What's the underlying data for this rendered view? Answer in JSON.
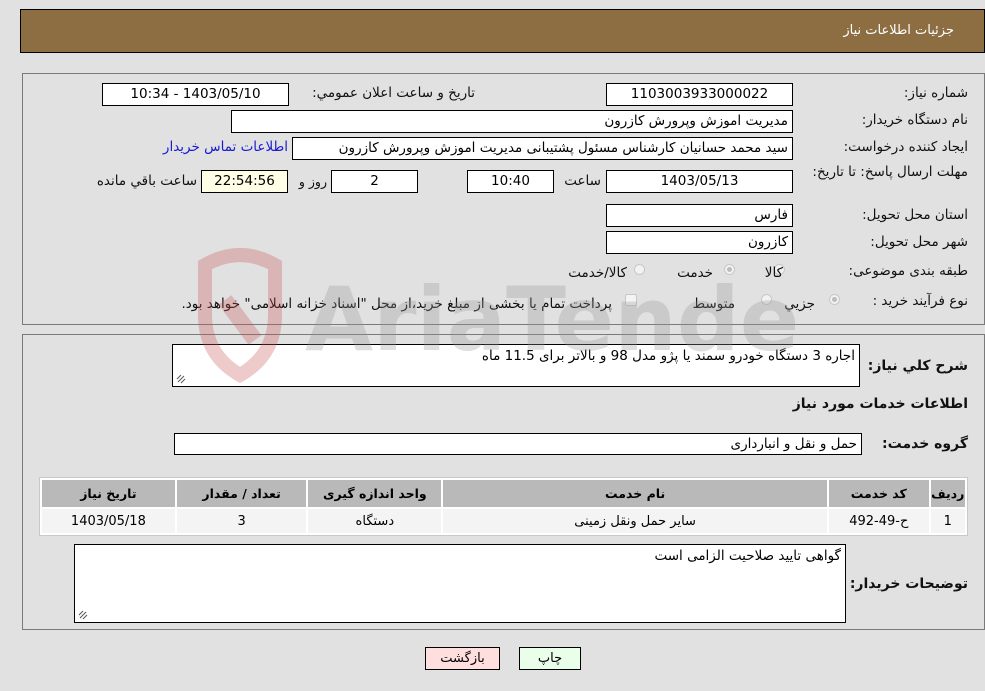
{
  "header": {
    "title": "جزئیات اطلاعات نیاز"
  },
  "form": {
    "need_number": {
      "label": "شماره نیاز:",
      "value": "1103003933000022"
    },
    "announce": {
      "label": "تاریخ و ساعت اعلان عمومي:",
      "value": "1403/05/10 - 10:34"
    },
    "buyer_org": {
      "label": "نام دستگاه خریدار:",
      "value": "مدیریت اموزش وپرورش کازرون"
    },
    "requester": {
      "label": "ایجاد کننده درخواست:",
      "value": "سید محمد  حسانیان  کارشناس مسئول پشتیبانی مدیریت اموزش وپرورش کازرون",
      "contact_link": "اطلاعات تماس خریدار"
    },
    "deadline": {
      "label": "مهلت ارسال پاسخ: تا تاریخ:",
      "date": "1403/05/13",
      "time_label": "ساعت",
      "time": "10:40",
      "days": "2",
      "days_label": "روز و",
      "remaining": "22:54:56",
      "remaining_label": "ساعت باقي مانده"
    },
    "province": {
      "label": "استان محل تحویل:",
      "value": "فارس"
    },
    "city": {
      "label": "شهر محل تحویل:",
      "value": "کازرون"
    },
    "category": {
      "label": "طبقه بندی موضوعی:",
      "options": [
        {
          "label": "کالا",
          "checked": false
        },
        {
          "label": "خدمت",
          "checked": true
        },
        {
          "label": "کالا/خدمت",
          "checked": false
        }
      ]
    },
    "process": {
      "label": "نوع فرآیند خرید :",
      "options": [
        {
          "label": "جزيي",
          "checked": true
        },
        {
          "label": "متوسط",
          "checked": false
        }
      ],
      "treasury_note": "پرداخت تمام یا بخشی از مبلغ خرید،از محل \"اسناد خزانه اسلامی\" خواهد بود."
    }
  },
  "details": {
    "description_label": "شرح کلي نیاز:",
    "description": "اجاره 3 دستگاه خودرو سمند یا پژو مدل 98 و بالاتر برای 11.5 ماه",
    "services_title": "اطلاعات خدمات مورد نیاز",
    "service_group_label": "گروه خدمت:",
    "service_group": "حمل و نقل و انبارداری",
    "table": {
      "headers": [
        "ردیف",
        "کد خدمت",
        "نام خدمت",
        "واحد اندازه گیری",
        "تعداد / مقدار",
        "تاریخ نیاز"
      ],
      "rows": [
        [
          "1",
          "ح-49-492",
          "سایر حمل ونقل زمینی",
          "دستگاه",
          "3",
          "1403/05/18"
        ]
      ]
    },
    "buyer_notes_label": "توضیحات خریدار:",
    "buyer_notes": "گواهی تایید صلاحیت الزامی است"
  },
  "buttons": {
    "print": "چاپ",
    "back": "بازگشت"
  },
  "colors": {
    "header_bg": "#8d6e43",
    "print_bg": "#eaffea",
    "back_bg": "#ffdede",
    "remaining_bg": "#ffffe8",
    "link": "#1a1ad0"
  }
}
